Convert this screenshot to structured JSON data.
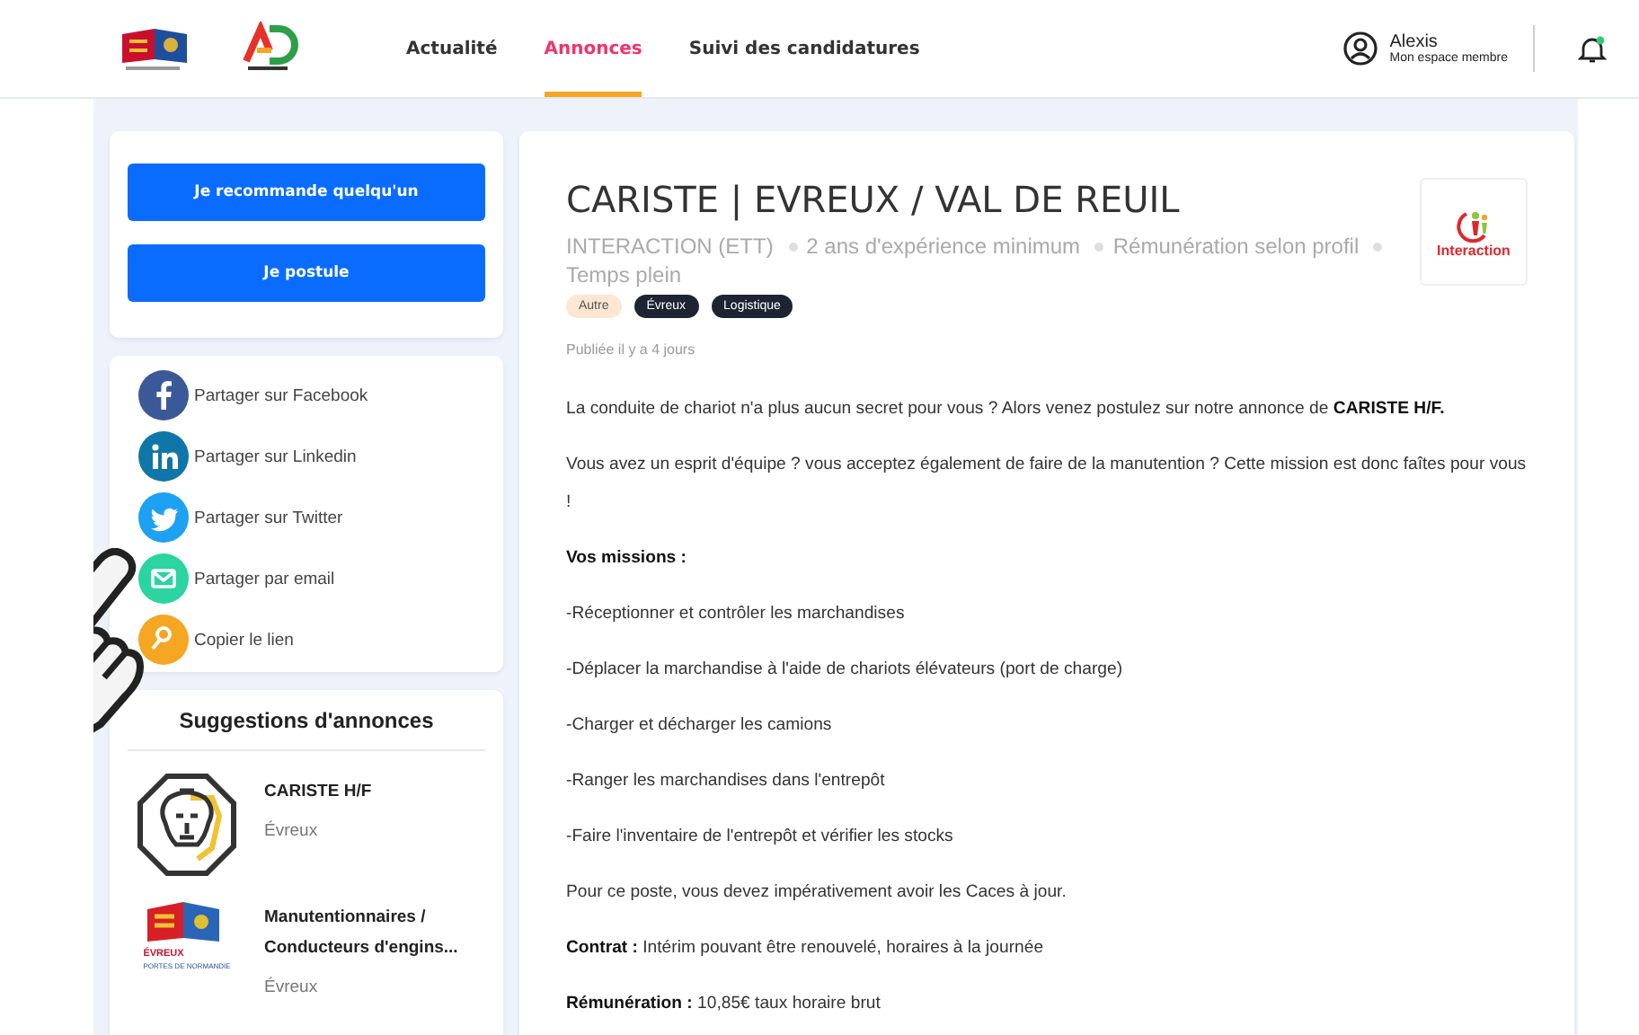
{
  "header": {
    "nav": [
      {
        "label": "Actualité",
        "selected": false
      },
      {
        "label": "Annonces",
        "selected": true
      },
      {
        "label": "Suivi des candidatures",
        "selected": false
      }
    ],
    "user": {
      "name": "Alexis",
      "subtitle": "Mon espace membre"
    }
  },
  "actions": [
    "Je recommande quelqu'un",
    "Je postule"
  ],
  "share": [
    {
      "label": "Partager sur Facebook",
      "kind": "facebook"
    },
    {
      "label": "Partager sur Linkedin",
      "kind": "linkedin"
    },
    {
      "label": "Partager sur Twitter",
      "kind": "twitter"
    },
    {
      "label": "Partager par email",
      "kind": "email"
    },
    {
      "label": "Copier le lien",
      "kind": "link"
    }
  ],
  "suggestions": {
    "title": "Suggestions d'annonces",
    "items": [
      {
        "title": "CARISTE H/F",
        "location": "Évreux",
        "kind": "lion"
      },
      {
        "title": "Manutentionnaires / Conducteurs d'engins...",
        "location": "Évreux",
        "kind": "city",
        "logo_text": [
          "ÉVREUX",
          "PORTES DE NORMANDIE"
        ]
      }
    ]
  },
  "job": {
    "title": "CARISTE | EVREUX / VAL DE REUIL",
    "meta": [
      "INTERACTION (ETT)",
      "2 ans d'expérience minimum",
      "Rémunération selon profil",
      "Temps plein"
    ],
    "tags": [
      {
        "label": "Autre",
        "kind": "category"
      },
      {
        "label": "Évreux",
        "kind": "place"
      },
      {
        "label": "Logistique",
        "kind": "place"
      }
    ],
    "published": "Publiée il y a 4 jours",
    "company_logo": "Interaction",
    "body": [
      "La conduite de chariot n'a plus aucun secret pour vous ? Alors venez postulez sur notre annonce de **CARISTE H/F.**",
      "Vous avez un esprit d'équipe ? vous acceptez également de faire de la manutention ? Cette mission est donc faîtes pour vous !",
      "**Vos missions :**",
      "-Réceptionner et contrôler les marchandises",
      "-Déplacer la marchandise à l'aide de chariots élévateurs (port de charge)",
      "-Charger et décharger les camions",
      "-Ranger les marchandises dans l'entrepôt",
      "-Faire l'inventaire de l'entrepôt et vérifier les stocks",
      "Pour ce poste, vous devez impérativement avoir les Caces à jour.",
      "**Contrat :** Intérim pouvant être renouvelé, horaires à la journée",
      "**Rémunération :** 10,85€ taux horaire brut"
    ]
  }
}
